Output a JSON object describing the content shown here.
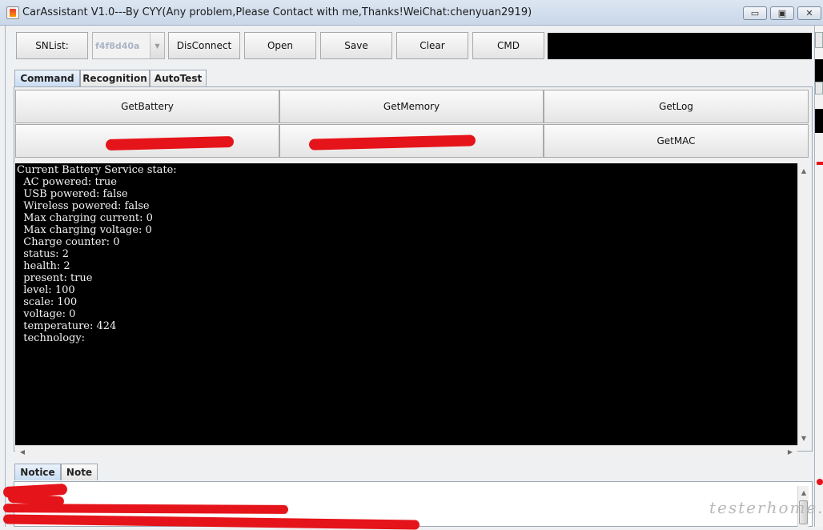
{
  "window": {
    "title": "CarAssistant V1.0---By CYY(Any problem,Please Contact with me,Thanks!WeiChat:chenyuan2919)",
    "controls": {
      "minimize": "▭",
      "maximize": "▣",
      "close": "✕"
    }
  },
  "toolbar": {
    "snlist_label": "SNList:",
    "sn_selected": "f4f8d40a",
    "disconnect_label": "DisConnect",
    "open_label": "Open",
    "save_label": "Save",
    "clear_label": "Clear",
    "cmd_label": "CMD",
    "cmd_value": ""
  },
  "tabs": [
    "Command",
    "Recognition",
    "AutoTest"
  ],
  "active_tab": "Command",
  "command_buttons": {
    "get_battery": "GetBattery",
    "get_memory": "GetMemory",
    "get_log": "GetLog",
    "get_mac": "GetMAC"
  },
  "console": {
    "text": "Current Battery Service state:\n  AC powered: true\n  USB powered: false\n  Wireless powered: false\n  Max charging current: 0\n  Max charging voltage: 0\n  Charge counter: 0\n  status: 2\n  health: 2\n  present: true\n  level: 100\n  scale: 100\n  voltage: 0\n  temperature: 424\n  technology:"
  },
  "bottom_tabs": [
    "Notice",
    "Note"
  ],
  "active_bottom_tab": "Notice",
  "watermark": "testerhome.com",
  "colors": {
    "redaction": "#e5141a",
    "console_bg": "#000000",
    "tab_active": "#c9ddf2"
  }
}
